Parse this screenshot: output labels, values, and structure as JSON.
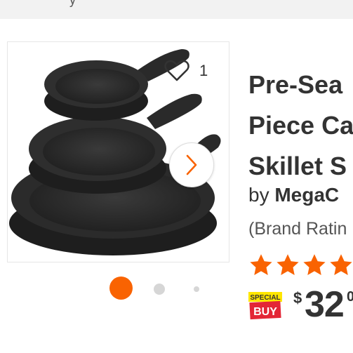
{
  "top_bar": {
    "text": "y"
  },
  "gallery": {
    "favorite_count": "1",
    "image_count": 3,
    "active_image_index": 1
  },
  "product": {
    "title_lines": [
      "Pre-Sea",
      "Piece Ca",
      "Skillet S"
    ],
    "by_label": "by",
    "brand": "MegaC",
    "brand_rating": "(Brand Ratin",
    "stars_shown": 4,
    "badge": {
      "line1": "SPECIAL",
      "line2": "BUY"
    },
    "price": {
      "currency": "$",
      "dollars": "32",
      "cents": "0"
    }
  },
  "colors": {
    "accent": "#f96302",
    "text": "#333333",
    "muted": "#d6d6d6",
    "badge_red": "#e32636",
    "badge_yellow": "#ffe600"
  }
}
